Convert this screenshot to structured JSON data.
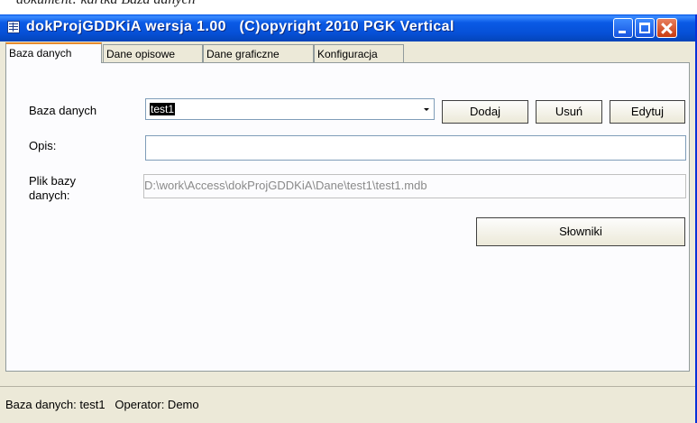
{
  "caption": "dokument: kartka Baza danych",
  "window": {
    "title": "dokProjGDDKiA wersja 1.00   (C)opyright 2010 PGK Vertical"
  },
  "tabs": [
    {
      "label": "Baza danych",
      "active": true
    },
    {
      "label": "Dane opisowe",
      "active": false
    },
    {
      "label": "Dane graficzne",
      "active": false
    },
    {
      "label": "Konfiguracja",
      "active": false
    }
  ],
  "form": {
    "database_label": "Baza danych",
    "database_value": "test1",
    "add_button": "Dodaj",
    "remove_button": "Usuń",
    "edit_button": "Edytuj",
    "description_label": "Opis:",
    "description_value": "",
    "file_label": "Plik bazy danych:",
    "file_value": "D:\\work\\Access\\dokProjGDDKiA\\Dane\\test1\\test1.mdb",
    "dictionaries_button": "Słowniki"
  },
  "status": {
    "text": "Baza danych: test1   Operator: Demo"
  },
  "colors": {
    "titlebar": "#0a5ae6",
    "window_bg": "#ece9d8",
    "panel_bg": "#fcfcfe",
    "close_button": "#c83a10"
  }
}
